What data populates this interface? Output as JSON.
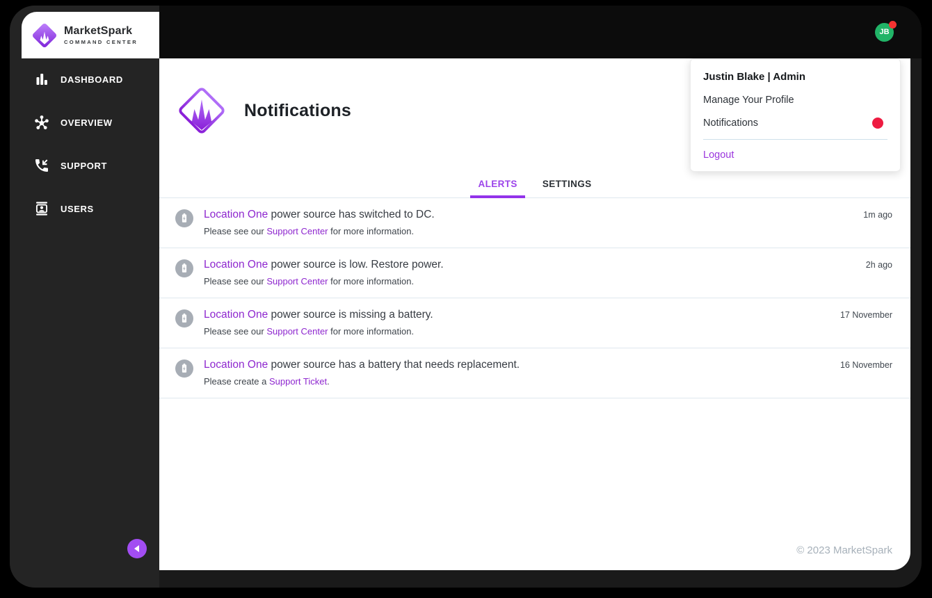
{
  "brand": {
    "title": "MarketSpark",
    "subtitle": "COMMAND CENTER"
  },
  "sidebar": {
    "items": [
      {
        "label": "DASHBOARD",
        "icon": "bar-chart-icon"
      },
      {
        "label": "OVERVIEW",
        "icon": "hub-icon"
      },
      {
        "label": "SUPPORT",
        "icon": "phone-callback-icon"
      },
      {
        "label": "USERS",
        "icon": "contact-card-icon"
      }
    ]
  },
  "topbar": {
    "avatar_initials": "JB"
  },
  "user_menu": {
    "header": "Justin Blake | Admin",
    "items": [
      {
        "label": "Manage Your Profile",
        "badge": false
      },
      {
        "label": "Notifications",
        "badge": true
      }
    ],
    "logout_label": "Logout"
  },
  "page": {
    "title": "Notifications"
  },
  "tabs": [
    {
      "label": "ALERTS",
      "active": true
    },
    {
      "label": "SETTINGS",
      "active": false
    }
  ],
  "notifications": [
    {
      "location": "Location One",
      "title_rest": " power source has switched to DC.",
      "body_prefix": "Please see our ",
      "body_link": "Support Center",
      "body_suffix": " for more information.",
      "timestamp": "1m ago",
      "icon": "battery-icon"
    },
    {
      "location": "Location One",
      "title_rest": " power source is low. Restore power.",
      "body_prefix": "Please see our ",
      "body_link": "Support Center",
      "body_suffix": " for more information.",
      "timestamp": "2h ago",
      "icon": "battery-icon"
    },
    {
      "location": "Location One",
      "title_rest": " power source is missing a battery.",
      "body_prefix": "Please see our ",
      "body_link": "Support Center",
      "body_suffix": " for more information.",
      "timestamp": "17 November",
      "icon": "battery-icon"
    },
    {
      "location": "Location One",
      "title_rest": " power source has a battery that needs replacement.",
      "body_prefix": "Please create a ",
      "body_link": "Support Ticket",
      "body_suffix": ".",
      "timestamp": "16 November",
      "icon": "battery-icon"
    }
  ],
  "footer": {
    "copyright": "© 2023 MarketSpark"
  },
  "colors": {
    "accent_purple": "#9333ea",
    "link_purple": "#8e27cf",
    "alert_red": "#ee1b41",
    "avatar_green": "#21b467",
    "sidebar_bg": "#242424",
    "topbar_bg": "#0c0c0c",
    "divider": "#dfe8ee",
    "icon_grey": "#a7adb5"
  }
}
